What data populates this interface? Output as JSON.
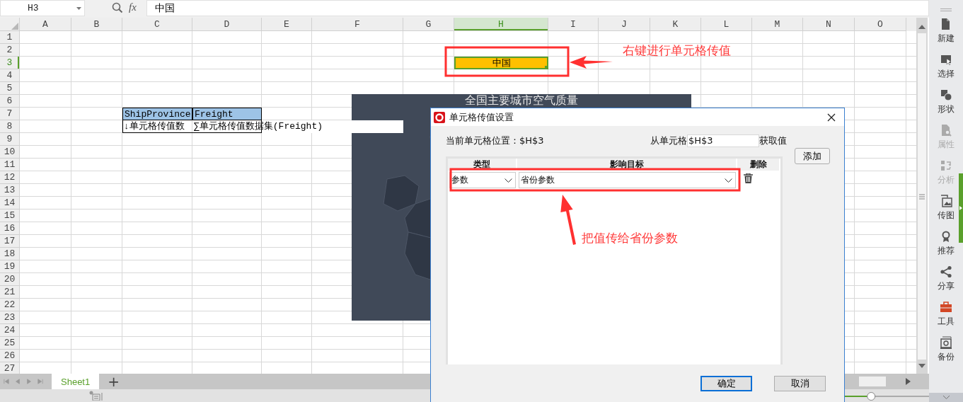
{
  "name_box": {
    "value": "H3"
  },
  "formula_bar": {
    "label": "fx",
    "value": "中国"
  },
  "columns": [
    {
      "label": "A",
      "selected": false
    },
    {
      "label": "B",
      "selected": false
    },
    {
      "label": "C",
      "selected": false
    },
    {
      "label": "D",
      "selected": false
    },
    {
      "label": "E",
      "selected": false
    },
    {
      "label": "F",
      "selected": false
    },
    {
      "label": "G",
      "selected": false
    },
    {
      "label": "H",
      "selected": true
    },
    {
      "label": "I",
      "selected": false
    },
    {
      "label": "J",
      "selected": false
    },
    {
      "label": "K",
      "selected": false
    },
    {
      "label": "L",
      "selected": false
    },
    {
      "label": "M",
      "selected": false
    },
    {
      "label": "N",
      "selected": false
    },
    {
      "label": "O",
      "selected": false
    }
  ],
  "rows": [
    {
      "label": "1",
      "selected": false
    },
    {
      "label": "2",
      "selected": false
    },
    {
      "label": "3",
      "selected": true
    },
    {
      "label": "4",
      "selected": false
    },
    {
      "label": "5",
      "selected": false
    },
    {
      "label": "6",
      "selected": false
    },
    {
      "label": "7",
      "selected": false
    },
    {
      "label": "8",
      "selected": false
    },
    {
      "label": "9",
      "selected": false
    },
    {
      "label": "10",
      "selected": false
    },
    {
      "label": "11",
      "selected": false
    },
    {
      "label": "12",
      "selected": false
    },
    {
      "label": "13",
      "selected": false
    },
    {
      "label": "14",
      "selected": false
    },
    {
      "label": "15",
      "selected": false
    },
    {
      "label": "16",
      "selected": false
    },
    {
      "label": "17",
      "selected": false
    },
    {
      "label": "18",
      "selected": false
    },
    {
      "label": "19",
      "selected": false
    },
    {
      "label": "20",
      "selected": false
    },
    {
      "label": "21",
      "selected": false
    },
    {
      "label": "22",
      "selected": false
    },
    {
      "label": "23",
      "selected": false
    },
    {
      "label": "24",
      "selected": false
    },
    {
      "label": "25",
      "selected": false
    },
    {
      "label": "26",
      "selected": false
    },
    {
      "label": "27",
      "selected": false
    }
  ],
  "cells": [
    {
      "text": "ShipProvince",
      "kind": "header"
    },
    {
      "text": "Freight",
      "kind": "header"
    },
    {
      "text": "↓单元格传值数",
      "kind": "field"
    },
    {
      "text": "∑单元格传值数据集(Freight)",
      "kind": "field"
    },
    {
      "text": "中国",
      "kind": "selected"
    }
  ],
  "chart_picture": {
    "title": "全国主要城市空气质量"
  },
  "annotations": [
    {
      "text": "右键进行单元格传值"
    },
    {
      "text": "把值传给省份参数"
    }
  ],
  "dialog": {
    "title": "单元格传值设置",
    "current_label": "当前单元格位置：$H$3",
    "from_label": "从单元格",
    "from_value": "$H$3",
    "get_label": "获取值",
    "add_button": "添加",
    "columns": [
      "类型",
      "影响目标",
      "删除"
    ],
    "rows": [
      {
        "type": "参数",
        "target": "省份参数"
      }
    ],
    "ok_button": "确定",
    "cancel_button": "取消"
  },
  "sheet_tabs": [
    {
      "label": "Sheet1",
      "selected": true
    }
  ],
  "add_sheet": "+",
  "zoom_slider": {
    "level": 0.45
  },
  "sidebar": {
    "items": [
      {
        "label": "新建",
        "disabled": false
      },
      {
        "label": "选择",
        "disabled": false
      },
      {
        "label": "形状",
        "disabled": false
      },
      {
        "label": "属性",
        "disabled": true
      },
      {
        "label": "分析",
        "disabled": true
      },
      {
        "label": "传图",
        "disabled": false
      },
      {
        "label": "推荐",
        "disabled": false
      },
      {
        "label": "分享",
        "disabled": false
      },
      {
        "label": "工具",
        "disabled": false
      },
      {
        "label": "备份",
        "disabled": false
      }
    ]
  }
}
